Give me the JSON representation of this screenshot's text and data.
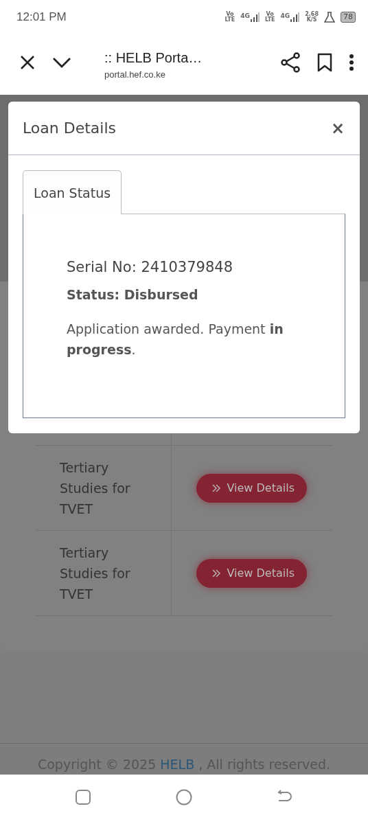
{
  "status_bar": {
    "time": "12:01 PM",
    "sims": [
      {
        "volte_top": "Vo",
        "volte_bottom": "LTE",
        "network": "4G"
      },
      {
        "volte_top": "Vo",
        "volte_bottom": "LTE",
        "network": "4G"
      }
    ],
    "speed": "2.68",
    "speed_unit": "K/S",
    "battery": "78"
  },
  "browser": {
    "title": ":: HELB Porta…",
    "url": "portal.hef.co.ke"
  },
  "modal": {
    "title": "Loan Details",
    "close": "×",
    "tabs": [
      {
        "label": "Loan Status",
        "selected": true
      }
    ],
    "serial": "Serial No: 2410379848",
    "status": "Status: Disbursed",
    "message": "Application awarded. Payment **in progress**."
  },
  "table": {
    "rows": [
      {
        "program": "Tertiary Studies for TVET",
        "button": "View Details"
      },
      {
        "program": "Tertiary Studies for TVET",
        "button": "View Details"
      }
    ]
  },
  "footer": {
    "prefix": "Copyright © 2025",
    "link": "HELB",
    "suffix": ", All rights reserved."
  }
}
